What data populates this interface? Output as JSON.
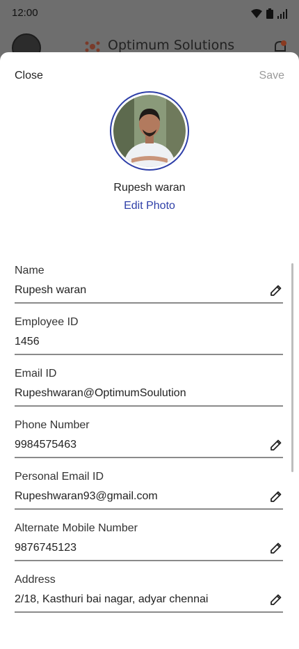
{
  "status_bar": {
    "time": "12:00",
    "icons": [
      "wifi-icon",
      "battery-icon",
      "signal-icon"
    ]
  },
  "background_app": {
    "brand": "Optimum Solutions"
  },
  "sheet": {
    "close_label": "Close",
    "save_label": "Save",
    "profile_name": "Rupesh waran",
    "edit_photo_label": "Edit Photo",
    "accent_color": "#2e3fa8",
    "fields": [
      {
        "label": "Name",
        "value": "Rupesh waran",
        "editable": true
      },
      {
        "label": "Employee ID",
        "value": "1456",
        "editable": false
      },
      {
        "label": "Email ID",
        "value": "Rupeshwaran@OptimumSoulution",
        "editable": false
      },
      {
        "label": "Phone Number",
        "value": "9984575463",
        "editable": true
      },
      {
        "label": "Personal Email ID",
        "value": "Rupeshwaran93@gmail.com",
        "editable": true
      },
      {
        "label": "Alternate Mobile Number",
        "value": "9876745123",
        "editable": true
      },
      {
        "label": "Address",
        "value": "2/18, Kasthuri bai nagar, adyar chennai",
        "editable": true
      }
    ]
  }
}
